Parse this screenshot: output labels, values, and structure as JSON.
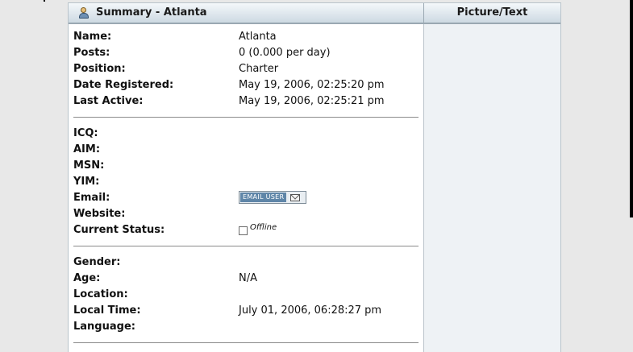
{
  "header": {
    "title": "Summary - Atlanta",
    "right_title": "Picture/Text",
    "icon": "user-icon"
  },
  "summary": [
    {
      "label": "Name:",
      "value": "Atlanta"
    },
    {
      "label": "Posts:",
      "value": "0 (0.000 per day)"
    },
    {
      "label": "Position:",
      "value": "Charter"
    },
    {
      "label": "Date Registered:",
      "value": "May 19, 2006, 02:25:20 pm"
    },
    {
      "label": "Last Active:",
      "value": "May 19, 2006, 02:25:21 pm"
    }
  ],
  "contact": {
    "icq": "ICQ:",
    "aim": "AIM:",
    "msn": "MSN:",
    "yim": "YIM:",
    "email": "Email:",
    "email_button": "EMAIL USER",
    "website": "Website:",
    "status_label": "Current Status:",
    "status_value": "Offline"
  },
  "personal": [
    {
      "label": "Gender:",
      "value": ""
    },
    {
      "label": "Age:",
      "value": "N/A"
    },
    {
      "label": "Location:",
      "value": ""
    },
    {
      "label": "Local Time:",
      "value": "July 01, 2006, 06:28:27 pm"
    },
    {
      "label": "Language:",
      "value": ""
    }
  ]
}
